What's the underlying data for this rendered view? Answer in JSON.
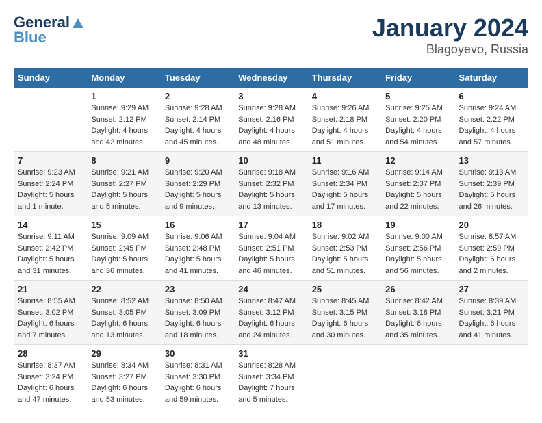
{
  "header": {
    "logo_line1": "General",
    "logo_line2": "Blue",
    "title": "January 2024",
    "subtitle": "Blagoyevo, Russia"
  },
  "days_of_week": [
    "Sunday",
    "Monday",
    "Tuesday",
    "Wednesday",
    "Thursday",
    "Friday",
    "Saturday"
  ],
  "weeks": [
    [
      {
        "day": "",
        "content": ""
      },
      {
        "day": "1",
        "content": "Sunrise: 9:29 AM\nSunset: 2:12 PM\nDaylight: 4 hours\nand 42 minutes."
      },
      {
        "day": "2",
        "content": "Sunrise: 9:28 AM\nSunset: 2:14 PM\nDaylight: 4 hours\nand 45 minutes."
      },
      {
        "day": "3",
        "content": "Sunrise: 9:28 AM\nSunset: 2:16 PM\nDaylight: 4 hours\nand 48 minutes."
      },
      {
        "day": "4",
        "content": "Sunrise: 9:26 AM\nSunset: 2:18 PM\nDaylight: 4 hours\nand 51 minutes."
      },
      {
        "day": "5",
        "content": "Sunrise: 9:25 AM\nSunset: 2:20 PM\nDaylight: 4 hours\nand 54 minutes."
      },
      {
        "day": "6",
        "content": "Sunrise: 9:24 AM\nSunset: 2:22 PM\nDaylight: 4 hours\nand 57 minutes."
      }
    ],
    [
      {
        "day": "7",
        "content": "Sunrise: 9:23 AM\nSunset: 2:24 PM\nDaylight: 5 hours\nand 1 minute."
      },
      {
        "day": "8",
        "content": "Sunrise: 9:21 AM\nSunset: 2:27 PM\nDaylight: 5 hours\nand 5 minutes."
      },
      {
        "day": "9",
        "content": "Sunrise: 9:20 AM\nSunset: 2:29 PM\nDaylight: 5 hours\nand 9 minutes."
      },
      {
        "day": "10",
        "content": "Sunrise: 9:18 AM\nSunset: 2:32 PM\nDaylight: 5 hours\nand 13 minutes."
      },
      {
        "day": "11",
        "content": "Sunrise: 9:16 AM\nSunset: 2:34 PM\nDaylight: 5 hours\nand 17 minutes."
      },
      {
        "day": "12",
        "content": "Sunrise: 9:14 AM\nSunset: 2:37 PM\nDaylight: 5 hours\nand 22 minutes."
      },
      {
        "day": "13",
        "content": "Sunrise: 9:13 AM\nSunset: 2:39 PM\nDaylight: 5 hours\nand 26 minutes."
      }
    ],
    [
      {
        "day": "14",
        "content": "Sunrise: 9:11 AM\nSunset: 2:42 PM\nDaylight: 5 hours\nand 31 minutes."
      },
      {
        "day": "15",
        "content": "Sunrise: 9:09 AM\nSunset: 2:45 PM\nDaylight: 5 hours\nand 36 minutes."
      },
      {
        "day": "16",
        "content": "Sunrise: 9:06 AM\nSunset: 2:48 PM\nDaylight: 5 hours\nand 41 minutes."
      },
      {
        "day": "17",
        "content": "Sunrise: 9:04 AM\nSunset: 2:51 PM\nDaylight: 5 hours\nand 46 minutes."
      },
      {
        "day": "18",
        "content": "Sunrise: 9:02 AM\nSunset: 2:53 PM\nDaylight: 5 hours\nand 51 minutes."
      },
      {
        "day": "19",
        "content": "Sunrise: 9:00 AM\nSunset: 2:56 PM\nDaylight: 5 hours\nand 56 minutes."
      },
      {
        "day": "20",
        "content": "Sunrise: 8:57 AM\nSunset: 2:59 PM\nDaylight: 6 hours\nand 2 minutes."
      }
    ],
    [
      {
        "day": "21",
        "content": "Sunrise: 8:55 AM\nSunset: 3:02 PM\nDaylight: 6 hours\nand 7 minutes."
      },
      {
        "day": "22",
        "content": "Sunrise: 8:52 AM\nSunset: 3:05 PM\nDaylight: 6 hours\nand 13 minutes."
      },
      {
        "day": "23",
        "content": "Sunrise: 8:50 AM\nSunset: 3:09 PM\nDaylight: 6 hours\nand 18 minutes."
      },
      {
        "day": "24",
        "content": "Sunrise: 8:47 AM\nSunset: 3:12 PM\nDaylight: 6 hours\nand 24 minutes."
      },
      {
        "day": "25",
        "content": "Sunrise: 8:45 AM\nSunset: 3:15 PM\nDaylight: 6 hours\nand 30 minutes."
      },
      {
        "day": "26",
        "content": "Sunrise: 8:42 AM\nSunset: 3:18 PM\nDaylight: 6 hours\nand 35 minutes."
      },
      {
        "day": "27",
        "content": "Sunrise: 8:39 AM\nSunset: 3:21 PM\nDaylight: 6 hours\nand 41 minutes."
      }
    ],
    [
      {
        "day": "28",
        "content": "Sunrise: 8:37 AM\nSunset: 3:24 PM\nDaylight: 6 hours\nand 47 minutes."
      },
      {
        "day": "29",
        "content": "Sunrise: 8:34 AM\nSunset: 3:27 PM\nDaylight: 6 hours\nand 53 minutes."
      },
      {
        "day": "30",
        "content": "Sunrise: 8:31 AM\nSunset: 3:30 PM\nDaylight: 6 hours\nand 59 minutes."
      },
      {
        "day": "31",
        "content": "Sunrise: 8:28 AM\nSunset: 3:34 PM\nDaylight: 7 hours\nand 5 minutes."
      },
      {
        "day": "",
        "content": ""
      },
      {
        "day": "",
        "content": ""
      },
      {
        "day": "",
        "content": ""
      }
    ]
  ]
}
